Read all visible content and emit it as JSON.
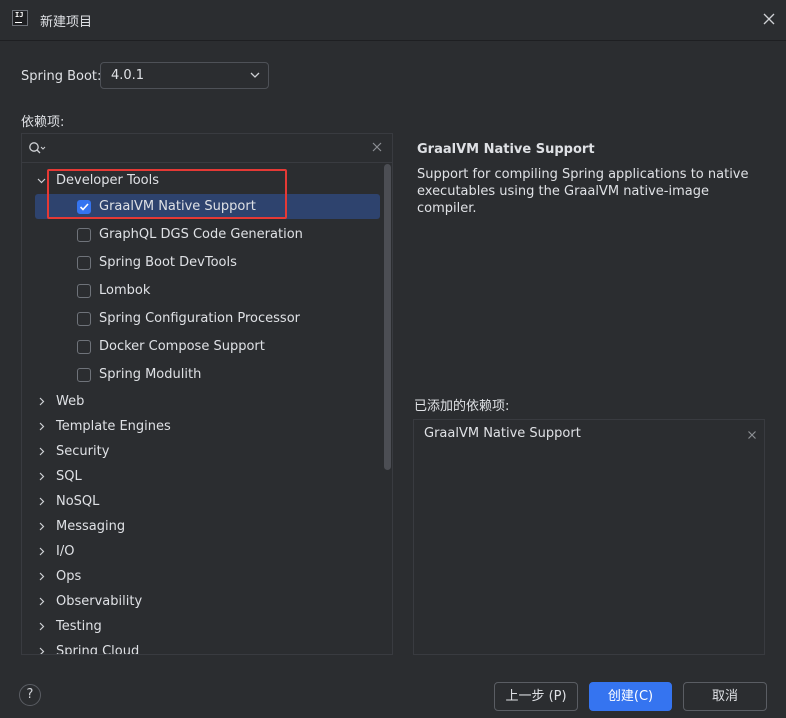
{
  "window": {
    "title": "新建项目"
  },
  "spring_boot": {
    "label": "Spring Boot:",
    "version": "4.0.1"
  },
  "dependencies": {
    "label": "依赖项:",
    "search": {
      "value": "",
      "placeholder": ""
    },
    "tree": [
      {
        "label": "Developer Tools",
        "expanded": true,
        "children": [
          {
            "label": "GraalVM Native Support",
            "checked": true,
            "selected": true
          },
          {
            "label": "GraphQL DGS Code Generation",
            "checked": false
          },
          {
            "label": "Spring Boot DevTools",
            "checked": false
          },
          {
            "label": "Lombok",
            "checked": false
          },
          {
            "label": "Spring Configuration Processor",
            "checked": false
          },
          {
            "label": "Docker Compose Support",
            "checked": false
          },
          {
            "label": "Spring Modulith",
            "checked": false
          }
        ]
      },
      {
        "label": "Web",
        "expanded": false
      },
      {
        "label": "Template Engines",
        "expanded": false
      },
      {
        "label": "Security",
        "expanded": false
      },
      {
        "label": "SQL",
        "expanded": false
      },
      {
        "label": "NoSQL",
        "expanded": false
      },
      {
        "label": "Messaging",
        "expanded": false
      },
      {
        "label": "I/O",
        "expanded": false
      },
      {
        "label": "Ops",
        "expanded": false
      },
      {
        "label": "Observability",
        "expanded": false
      },
      {
        "label": "Testing",
        "expanded": false
      },
      {
        "label": "Spring Cloud",
        "expanded": false
      }
    ]
  },
  "detail": {
    "title": "GraalVM Native Support",
    "description": "Support for compiling Spring applications to native executables using the GraalVM native-image compiler."
  },
  "added": {
    "label": "已添加的依赖项:",
    "items": [
      "GraalVM Native Support"
    ]
  },
  "buttons": {
    "help": "?",
    "previous": "上一步 (P)",
    "create": "创建(C)",
    "cancel": "取消"
  },
  "colors": {
    "background": "#2b2d30",
    "selection": "#2e436e",
    "accent": "#3574f0",
    "highlight_border": "#e53935"
  }
}
